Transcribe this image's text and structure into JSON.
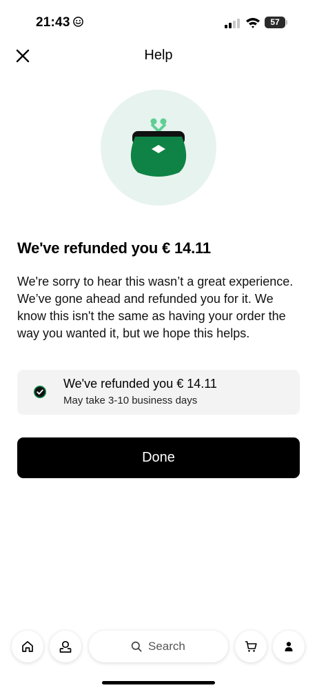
{
  "status_bar": {
    "time": "21:43",
    "battery": "57"
  },
  "header": {
    "title": "Help"
  },
  "refund": {
    "title": "We've refunded you € 14.11",
    "description": "We're sorry to hear this wasn’t a great experience. We’ve gone ahead and refunded you for it. We know this isn't the same as having your order the way you wanted it, but we hope this helps.",
    "card_title": "We've refunded you € 14.11",
    "card_subtitle": "May take 3-10 business days"
  },
  "actions": {
    "done_label": "Done"
  },
  "bottom_nav": {
    "search_label": "Search"
  },
  "icons": {
    "close": "close-icon",
    "purse": "purse-icon",
    "check": "check-circle-icon",
    "home": "home-icon",
    "pickup": "pickup-icon",
    "search": "search-icon",
    "cart": "cart-icon",
    "account": "account-icon"
  },
  "colors": {
    "accent_green": "#0e8345",
    "illustration_bg": "#e7f3ee",
    "button_bg": "#000000",
    "card_bg": "#f3f3f3"
  }
}
